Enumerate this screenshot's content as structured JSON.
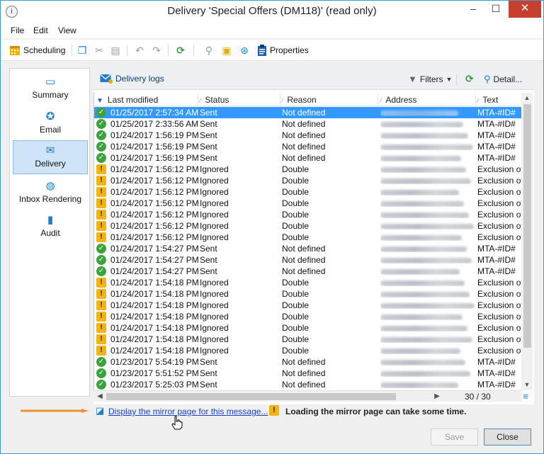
{
  "window": {
    "title": "Delivery 'Special Offers (DM118)' (read only)",
    "app_icon": "i",
    "min_glyph": "–",
    "max_glyph": "☐",
    "close_glyph": "✕"
  },
  "menu": [
    "File",
    "Edit",
    "View"
  ],
  "toolbar": {
    "scheduling": "Scheduling",
    "properties": "Properties"
  },
  "sidebar": {
    "items": [
      {
        "label": "Summary",
        "icon": "summary-icon",
        "glyph": "▭"
      },
      {
        "label": "Email",
        "icon": "email-icon",
        "glyph": "✪"
      },
      {
        "label": "Delivery",
        "icon": "delivery-icon",
        "glyph": "✉"
      },
      {
        "label": "Inbox Rendering",
        "icon": "inbox-rendering-icon",
        "glyph": "◍"
      },
      {
        "label": "Audit",
        "icon": "audit-icon",
        "glyph": "▮"
      }
    ],
    "active_index": 2
  },
  "panel": {
    "title": "Delivery logs",
    "filters": "Filters",
    "detail": "Detail..."
  },
  "grid": {
    "columns": [
      "Last modified",
      "Status",
      "Reason",
      "Address",
      "Text"
    ],
    "rows": [
      {
        "icon": "ok",
        "date": "01/25/2017 2:57:34 AM",
        "status": "Sent",
        "reason": "Not defined",
        "text": "MTA-#ID#"
      },
      {
        "icon": "ok",
        "date": "01/25/2017 2:33:56 AM",
        "status": "Sent",
        "reason": "Not defined",
        "text": "MTA-#ID#"
      },
      {
        "icon": "ok",
        "date": "01/24/2017 1:56:19 PM",
        "status": "Sent",
        "reason": "Not defined",
        "text": "MTA-#ID#"
      },
      {
        "icon": "ok",
        "date": "01/24/2017 1:56:19 PM",
        "status": "Sent",
        "reason": "Not defined",
        "text": "MTA-#ID#"
      },
      {
        "icon": "ok",
        "date": "01/24/2017 1:56:19 PM",
        "status": "Sent",
        "reason": "Not defined",
        "text": "MTA-#ID#"
      },
      {
        "icon": "warn",
        "date": "01/24/2017 1:56:12 PM",
        "status": "Ignored",
        "reason": "Double",
        "text": "Exclusion of"
      },
      {
        "icon": "warn",
        "date": "01/24/2017 1:56:12 PM",
        "status": "Ignored",
        "reason": "Double",
        "text": "Exclusion of"
      },
      {
        "icon": "warn",
        "date": "01/24/2017 1:56:12 PM",
        "status": "Ignored",
        "reason": "Double",
        "text": "Exclusion of"
      },
      {
        "icon": "warn",
        "date": "01/24/2017 1:56:12 PM",
        "status": "Ignored",
        "reason": "Double",
        "text": "Exclusion of"
      },
      {
        "icon": "warn",
        "date": "01/24/2017 1:56:12 PM",
        "status": "Ignored",
        "reason": "Double",
        "text": "Exclusion of"
      },
      {
        "icon": "warn",
        "date": "01/24/2017 1:56:12 PM",
        "status": "Ignored",
        "reason": "Double",
        "text": "Exclusion of"
      },
      {
        "icon": "warn",
        "date": "01/24/2017 1:56:12 PM",
        "status": "Ignored",
        "reason": "Double",
        "text": "Exclusion of"
      },
      {
        "icon": "ok",
        "date": "01/24/2017 1:54:27 PM",
        "status": "Sent",
        "reason": "Not defined",
        "text": "MTA-#ID#"
      },
      {
        "icon": "ok",
        "date": "01/24/2017 1:54:27 PM",
        "status": "Sent",
        "reason": "Not defined",
        "text": "MTA-#ID#"
      },
      {
        "icon": "ok",
        "date": "01/24/2017 1:54:27 PM",
        "status": "Sent",
        "reason": "Not defined",
        "text": "MTA-#ID#"
      },
      {
        "icon": "warn",
        "date": "01/24/2017 1:54:18 PM",
        "status": "Ignored",
        "reason": "Double",
        "text": "Exclusion of"
      },
      {
        "icon": "warn",
        "date": "01/24/2017 1:54:18 PM",
        "status": "Ignored",
        "reason": "Double",
        "text": "Exclusion of"
      },
      {
        "icon": "warn",
        "date": "01/24/2017 1:54:18 PM",
        "status": "Ignored",
        "reason": "Double",
        "text": "Exclusion of"
      },
      {
        "icon": "warn",
        "date": "01/24/2017 1:54:18 PM",
        "status": "Ignored",
        "reason": "Double",
        "text": "Exclusion of"
      },
      {
        "icon": "warn",
        "date": "01/24/2017 1:54:18 PM",
        "status": "Ignored",
        "reason": "Double",
        "text": "Exclusion of"
      },
      {
        "icon": "warn",
        "date": "01/24/2017 1:54:18 PM",
        "status": "Ignored",
        "reason": "Double",
        "text": "Exclusion of"
      },
      {
        "icon": "warn",
        "date": "01/24/2017 1:54:18 PM",
        "status": "Ignored",
        "reason": "Double",
        "text": "Exclusion of"
      },
      {
        "icon": "ok",
        "date": "01/23/2017 5:54:19 PM",
        "status": "Sent",
        "reason": "Not defined",
        "text": "MTA-#ID#"
      },
      {
        "icon": "ok",
        "date": "01/23/2017 5:51:52 PM",
        "status": "Sent",
        "reason": "Not defined",
        "text": "MTA-#ID#"
      },
      {
        "icon": "ok",
        "date": "01/23/2017 5:25:03 PM",
        "status": "Sent",
        "reason": "Not defined",
        "text": "MTA-#ID#"
      }
    ],
    "selected_index": 0,
    "count": "30 / 30"
  },
  "footer": {
    "mirror_link": "Display the mirror page for this message...",
    "notice": "Loading the mirror page can take some time.",
    "save": "Save",
    "close": "Close"
  },
  "colors": {
    "accent": "#3399ff",
    "ok": "#3aa43a",
    "warn": "#f3b310",
    "link": "#1a3ec6",
    "pointer_arrow": "#f0922e"
  }
}
